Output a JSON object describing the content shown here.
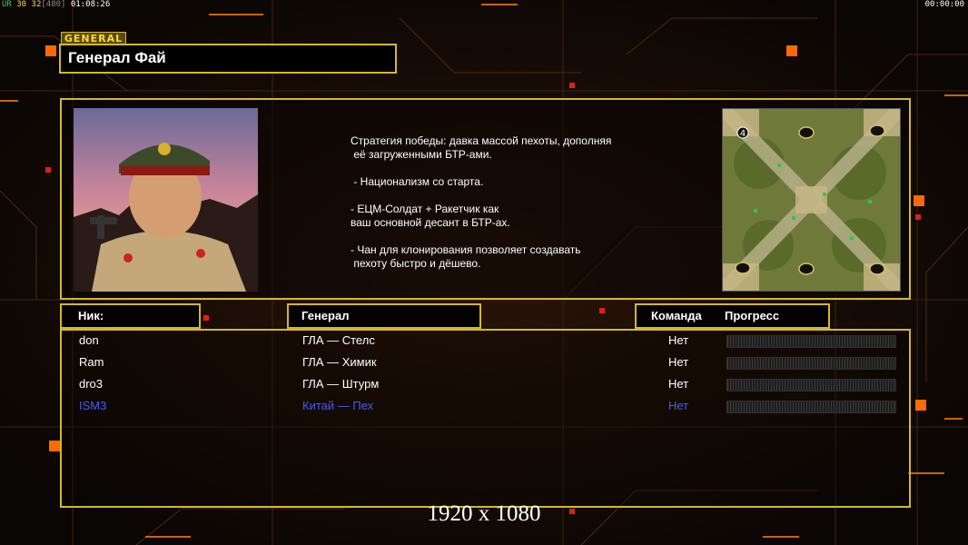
{
  "hud": {
    "left_prefix": "UR",
    "left_a": "30",
    "left_b": "32",
    "left_c": "[480]",
    "left_time": "01:08:26",
    "right_time": "00:00:00"
  },
  "header": {
    "section_tag": "GENERAL",
    "general_name": "Генерал Фай"
  },
  "strategy_lines": [
    "Стратегия победы: давка массой пехоты, дополняя",
    " её загруженными БТР-ами.",
    "",
    " - Национализм со старта.",
    "",
    "- ЕЦМ-Солдат + Ракетчик как",
    "ваш основной десант в БТР-ах.",
    "",
    "- Чан для клонирования позволяет создавать",
    " пехоту быстро и дёшево."
  ],
  "minimap": {
    "player_slot_label": "4"
  },
  "columns": {
    "nick": "Ник:",
    "general": "Генерал",
    "team": "Команда",
    "progress": "Прогресс"
  },
  "players": [
    {
      "nick": "don",
      "general": "ГЛА — Стелс",
      "team": "Нет",
      "progress": 0,
      "color": "#ffffff"
    },
    {
      "nick": "Ram",
      "general": "ГЛА — Химик",
      "team": "Нет",
      "progress": 0,
      "color": "#ffffff"
    },
    {
      "nick": "dro3",
      "general": "ГЛА — Штурм",
      "team": "Нет",
      "progress": 0,
      "color": "#ffffff"
    },
    {
      "nick": "ISM3",
      "general": "Китай — Пех",
      "team": "Нет",
      "progress": 0,
      "color": "#4a5cf0"
    }
  ],
  "resolution_label": "1920 x 1080",
  "colors": {
    "accent": "#d4b82a",
    "orange": "#ff6a00",
    "player_blue": "#4a5cf0"
  }
}
